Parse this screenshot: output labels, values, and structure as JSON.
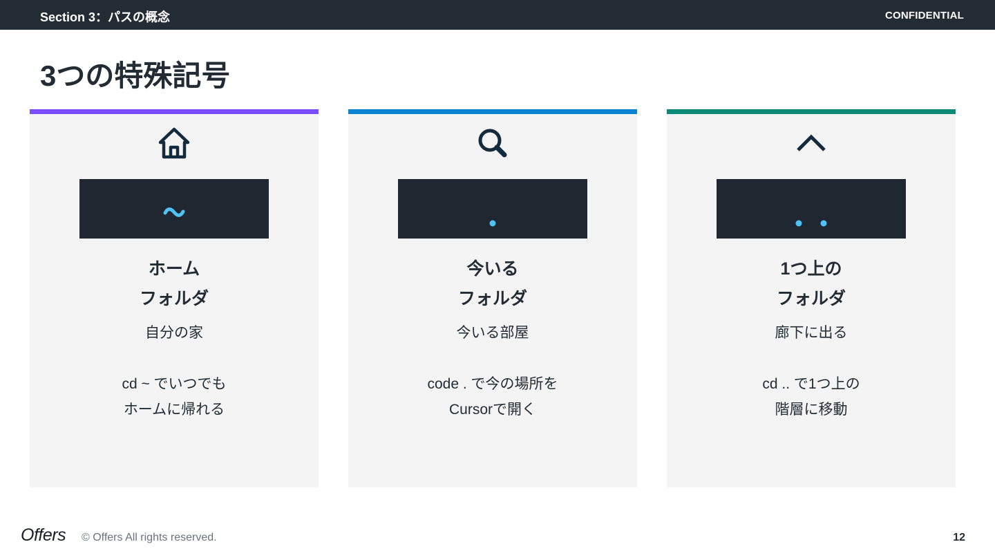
{
  "header": {
    "section": "Section 3：パスの概念",
    "confidential": "CONFIDENTIAL"
  },
  "title": "3つの特殊記号",
  "cards": [
    {
      "accent_color": "#7c4dff",
      "icon": "home-icon",
      "symbol": "~",
      "title_line1": "ホーム",
      "title_line2": "フォルダ",
      "desc_line1": "自分の家",
      "desc_line2": "cd ~ でいつでも",
      "desc_line3": "ホームに帰れる"
    },
    {
      "accent_color": "#0a84d0",
      "icon": "search-icon",
      "symbol": ".",
      "title_line1": "今いる",
      "title_line2": "フォルダ",
      "desc_line1": "今いる部屋",
      "desc_line2": "code . で今の場所を",
      "desc_line3": "Cursorで開く"
    },
    {
      "accent_color": "#0b8a78",
      "icon": "chevron-up-icon",
      "symbol": "..",
      "title_line1": "1つ上の",
      "title_line2": "フォルダ",
      "desc_line1": "廊下に出る",
      "desc_line2": "cd .. で1つ上の",
      "desc_line3": "階層に移動"
    }
  ],
  "symbol_color": "#4fc3f7",
  "footer": {
    "logo": "Offers",
    "copyright": "© Offers All rights reserved.",
    "page_number": "12"
  }
}
